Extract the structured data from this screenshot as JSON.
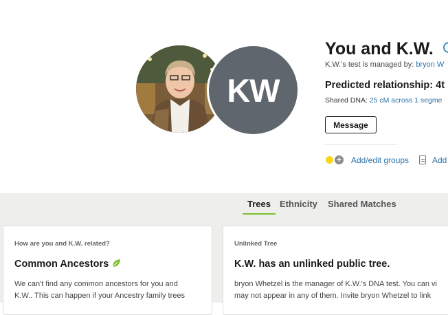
{
  "header": {
    "title": "You and K.W.",
    "managed_prefix": "K.W.'s test is managed by: ",
    "managed_by": "bryon W",
    "predicted_relationship": "Predicted relationship: 4t",
    "shared_dna_prefix": "Shared DNA: ",
    "shared_dna_value": "25 cM across 1 segme",
    "message_label": "Message",
    "initials": "KW",
    "group_color": "#f4d81c",
    "add_edit_groups": "Add/edit groups",
    "add_note": "Add"
  },
  "tabs": [
    {
      "label": "Trees",
      "active": true
    },
    {
      "label": "Ethnicity",
      "active": false
    },
    {
      "label": "Shared Matches",
      "active": false
    }
  ],
  "cards": {
    "left": {
      "eyebrow": "How are you and K.W. related?",
      "heading": "Common Ancestors",
      "body_line1": "We can't find any common ancestors for you and",
      "body_line2": "K.W.. This can happen if your Ancestry family trees"
    },
    "right": {
      "eyebrow": "Unlinked Tree",
      "heading": "K.W. has an unlinked public tree.",
      "body_line1": "bryon Whetzel is the manager of K.W.'s DNA test. You can vi",
      "body_line2": "may not appear in any of them. Invite bryon Whetzel to link"
    }
  },
  "colors": {
    "accent_green": "#7fbf2e",
    "link_blue": "#2d72a8",
    "avatar_gray": "#5f666d"
  }
}
